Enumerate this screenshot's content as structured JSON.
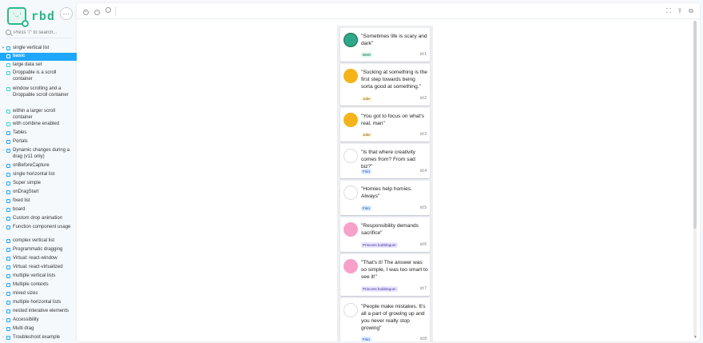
{
  "brand": {
    "name": "rbd",
    "menu_label": "···"
  },
  "search": {
    "placeholder": "Press \"/\" to search..."
  },
  "tree": [
    {
      "label": "single vertical list",
      "kind": "component",
      "expanded": true,
      "top": 0
    },
    {
      "label": "basic",
      "kind": "story",
      "selected": true
    },
    {
      "label": "large data set",
      "kind": "story"
    },
    {
      "label": "Droppable is a scroll container",
      "kind": "story"
    },
    {
      "label": "window scrolling and a Droppable scroll container",
      "kind": "story"
    },
    {
      "label": "within a larger scroll container",
      "kind": "story"
    },
    {
      "label": "with combine enabled",
      "kind": "story"
    },
    {
      "label": "Tables",
      "kind": "component"
    },
    {
      "label": "Portals",
      "kind": "component"
    },
    {
      "label": "Dynamic changes during a drag (v11 only)",
      "kind": "component"
    },
    {
      "label": "onBeforeCapture",
      "kind": "component"
    },
    {
      "label": "single horizontal list",
      "kind": "component"
    },
    {
      "label": "Super simple",
      "kind": "component"
    },
    {
      "label": "onDragStart",
      "kind": "component"
    },
    {
      "label": "fixed list",
      "kind": "component"
    },
    {
      "label": "board",
      "kind": "component"
    },
    {
      "label": "Custom drop animation",
      "kind": "component"
    },
    {
      "label": "Function component usage",
      "kind": "component"
    },
    {
      "label": "complex vertical list",
      "kind": "component"
    },
    {
      "label": "Programmatic dragging",
      "kind": "component"
    },
    {
      "label": "Virtual: react-window",
      "kind": "component"
    },
    {
      "label": "Virtual: react-virtualized",
      "kind": "component"
    },
    {
      "label": "multiple vertical lists",
      "kind": "component"
    },
    {
      "label": "Multiple contexts",
      "kind": "component"
    },
    {
      "label": "mixed sizes",
      "kind": "component"
    },
    {
      "label": "multiple horizontal lists",
      "kind": "component"
    },
    {
      "label": "nested interative elements",
      "kind": "component"
    },
    {
      "label": "Accessibility",
      "kind": "component"
    },
    {
      "label": "Multi drag",
      "kind": "component"
    },
    {
      "label": "Troubleshoot example",
      "kind": "component"
    }
  ],
  "quotes": [
    {
      "text": "\"Sometimes life is scary and dark\"",
      "author": "BMO",
      "id": "id:1",
      "avatar": "bmo"
    },
    {
      "text": "\"Sucking at something is the first step towards being sorta good at something.\"",
      "author": "Jake",
      "id": "id:2",
      "avatar": "jake"
    },
    {
      "text": "\"You got to focus on what's real, man\"",
      "author": "Jake",
      "id": "id:3",
      "avatar": "jake"
    },
    {
      "text": "\"Is that where creativity comes from? From sad biz?\"",
      "author": "Finn",
      "id": "id:4",
      "avatar": "finn"
    },
    {
      "text": "\"Homies help homies. Always\"",
      "author": "Finn",
      "id": "id:5",
      "avatar": "finn"
    },
    {
      "text": "\"Responsibility demands sacrifice\"",
      "author": "Princess bubblegum",
      "id": "id:6",
      "avatar": "pb"
    },
    {
      "text": "\"That's it! The answer was so simple, I was too smart to see it!\"",
      "author": "Princess bubblegum",
      "id": "id:7",
      "avatar": "pb"
    },
    {
      "text": "\"People make mistakes. It's all a part of growing up and you never really stop growing\"",
      "author": "Finn",
      "id": "id:8",
      "avatar": "finn"
    }
  ],
  "colors": {
    "accent": "#1ea7fd",
    "brand": "#2eb88a",
    "list_bg": "#eceef1"
  }
}
